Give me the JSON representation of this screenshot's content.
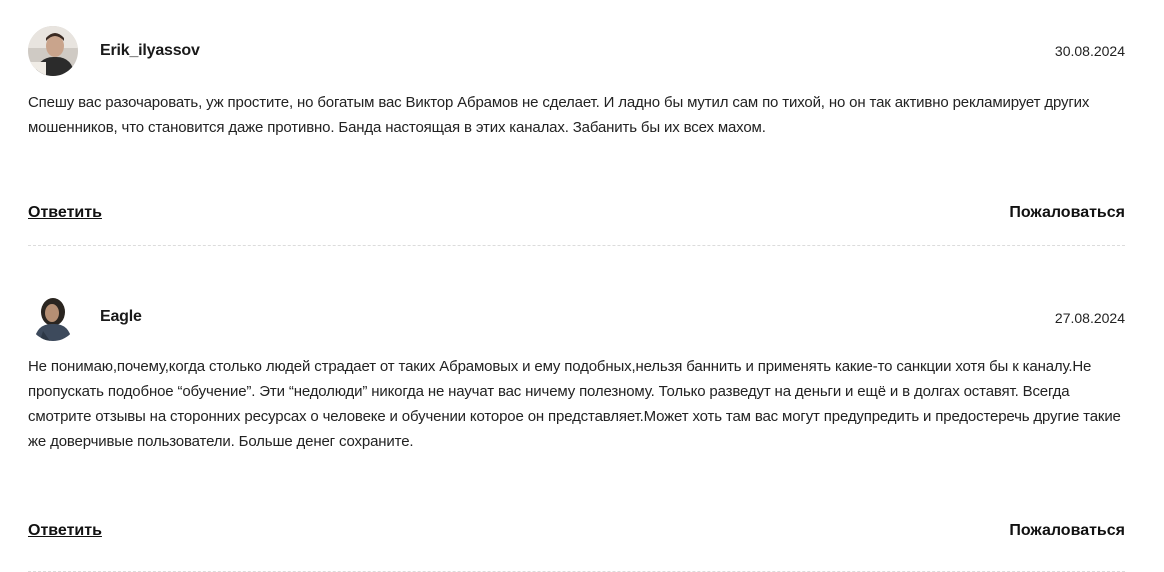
{
  "comments": [
    {
      "author": "Erik_ilyassov",
      "date": "30.08.2024",
      "text": "Спешу вас разочаровать, уж простите, но богатым вас Виктор Абрамов не сделает. И ладно бы мутил сам по тихой, но он так активно рекламирует других мошенников, что становится даже противно. Банда настоящая в этих каналах. Забанить бы их всех махом.",
      "reply_label": "Ответить",
      "report_label": "Пожаловаться"
    },
    {
      "author": "Eagle",
      "date": "27.08.2024",
      "text": "Не понимаю,почему,когда столько людей страдает от таких Абрамовых и ему подобных,нельзя баннить и применять какие-то санкции хотя бы к каналу.Не пропускать подобное “обучение”. Эти “недолюди” никогда не научат вас ничему полезному. Только разведут на деньги и ещё и в долгах оставят. Всегда смотрите отзывы на сторонних ресурсах о человеке и обучении которое он представляет.Может хоть там вас могут предупредить и предостеречь другие такие же доверчивые пользователи. Больше денег сохраните.",
      "reply_label": "Ответить",
      "report_label": "Пожаловаться"
    }
  ],
  "colors": {
    "text": "#222222",
    "divider": "#dcdcdc"
  }
}
